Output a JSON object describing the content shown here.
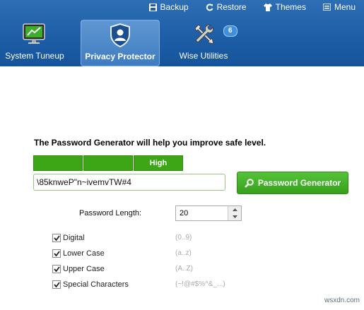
{
  "topmenu": [
    {
      "label": "Backup",
      "icon": "save-icon"
    },
    {
      "label": "Restore",
      "icon": "refresh-icon"
    },
    {
      "label": "Themes",
      "icon": "shirt-icon"
    },
    {
      "label": "Menu",
      "icon": "menu-icon"
    }
  ],
  "tabs": [
    {
      "label": "System Tuneup",
      "icon": "monitor-icon",
      "active": false
    },
    {
      "label": "Privacy Protector",
      "icon": "shield-user-icon",
      "active": true
    },
    {
      "label": "Wise Utilities",
      "icon": "tools-icon",
      "active": false,
      "badge": "6"
    }
  ],
  "main": {
    "intro": "The Password Generator will help you improve safe level.",
    "strength_label": "High",
    "password": "\\85knweP\"n~ivemvTW#4",
    "generate_button": "Password Generator",
    "length_label": "Password Length:",
    "length_value": "20",
    "options": [
      {
        "label": "Digital",
        "hint": "(0..9)",
        "checked": true
      },
      {
        "label": "Lower Case",
        "hint": "(a..z)",
        "checked": true
      },
      {
        "label": "Upper Case",
        "hint": "(A..Z)",
        "checked": true
      },
      {
        "label": "Special Characters",
        "hint": "(~!@#$%^&_...)",
        "checked": true
      }
    ]
  },
  "watermark": "wsxdn.com",
  "colors": {
    "header": "#1c5da6",
    "accent_green": "#3da617"
  }
}
